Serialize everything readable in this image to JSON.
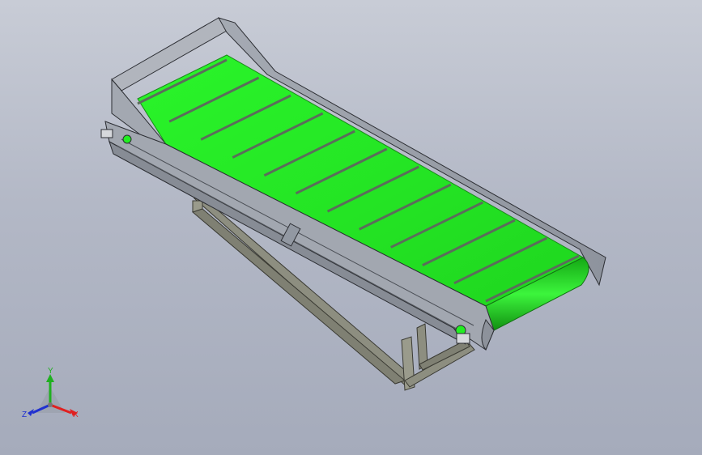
{
  "model": {
    "description_colors": {
      "belt": "#22ee22",
      "belt_dark": "#16b516",
      "cleat": "#5b6d5b",
      "frame": "#9aa0aa",
      "frame_dark": "#6f7580",
      "support": "#8d8e80",
      "background": "#b9bdc9"
    }
  },
  "triad": {
    "x_label": "X",
    "y_label": "Y",
    "z_label": "Z",
    "x_color": "#e02020",
    "y_color": "#20b020",
    "z_color": "#2030d0"
  }
}
